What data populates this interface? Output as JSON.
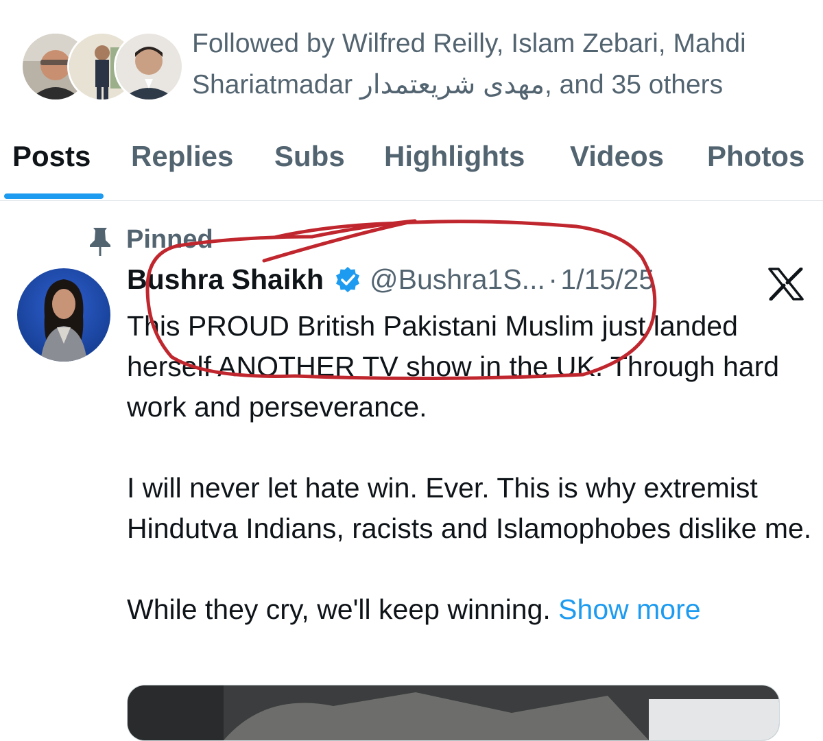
{
  "followers": {
    "text_line1": "Followed by Wilfred Reilly, Islam Zebari, Mahdi",
    "text_line2_prefix": "Shariatmadar ",
    "text_line2_arabic": "مهدی شریعتمدار",
    "text_line2_suffix": ", and 35 others"
  },
  "tabs": [
    {
      "label": "Posts",
      "active": true
    },
    {
      "label": "Replies"
    },
    {
      "label": "Subs"
    },
    {
      "label": "Highlights"
    },
    {
      "label": "Videos"
    },
    {
      "label": "Photos"
    }
  ],
  "post": {
    "pinned_label": "Pinned",
    "author_name": "Bushra Shaikh",
    "handle": "@Bushra1S...",
    "separator": "·",
    "date": "1/15/25",
    "paragraphs": [
      "This PROUD British Pakistani Muslim just landed herself ANOTHER TV show in the UK. Through hard work and perseverance.",
      "I will never let hate win. Ever. This is why extremist Hindutva Indians, racists and Islamophobes dislike me."
    ],
    "last_line": "While they cry, we'll keep winning.",
    "show_more": "Show more"
  },
  "icons": {
    "pin": "pin-icon",
    "verified": "verified-badge-icon",
    "platform": "x-logo-icon"
  },
  "colors": {
    "accent": "#1d9bf0",
    "secondary_text": "#536471",
    "annotation": "#c0262d"
  }
}
